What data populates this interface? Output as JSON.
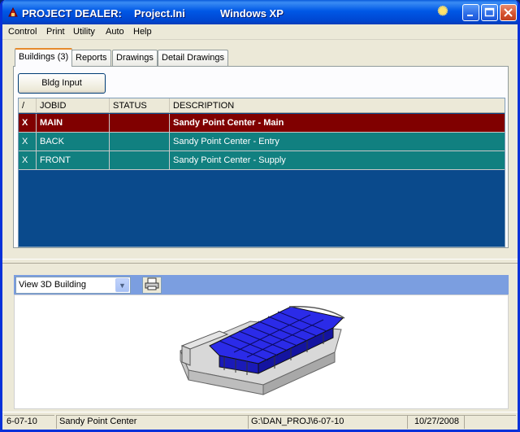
{
  "window": {
    "app_name": "PROJECT DEALER:",
    "project_file": "Project.Ini",
    "os_label": "Windows XP"
  },
  "menu": {
    "items": [
      {
        "label": "Control"
      },
      {
        "label": "Print"
      },
      {
        "label": "Utility"
      },
      {
        "label": "Auto"
      },
      {
        "label": "Help"
      }
    ]
  },
  "tabs": [
    {
      "label": "Buildings (3)",
      "active": true
    },
    {
      "label": "Reports",
      "active": false
    },
    {
      "label": "Drawings",
      "active": false
    },
    {
      "label": "Detail Drawings",
      "active": false
    }
  ],
  "buildings_panel": {
    "bldg_input_label": "Bldg Input",
    "columns": [
      {
        "label": "/"
      },
      {
        "label": "JOBID"
      },
      {
        "label": "STATUS"
      },
      {
        "label": "DESCRIPTION"
      }
    ],
    "rows": [
      {
        "mark": "X",
        "jobid": "MAIN",
        "status": "",
        "description": "Sandy Point Center - Main"
      },
      {
        "mark": "X",
        "jobid": "BACK",
        "status": "",
        "description": "Sandy Point Center - Entry"
      },
      {
        "mark": "X",
        "jobid": "FRONT",
        "status": "",
        "description": "Sandy Point Center - Supply"
      }
    ]
  },
  "viewer": {
    "selected_view": "View 3D Building",
    "print_icon": "printer-icon"
  },
  "status_bar": {
    "job_number": "6-07-10",
    "project_name": "Sandy Point Center",
    "path": "G:\\DAN_PROJ\\6-07-10",
    "date": "10/27/2008"
  },
  "colors": {
    "title_blue": "#0054e3",
    "selected_row": "#800000",
    "row_teal": "#118080",
    "grid_background": "#0a4a8c",
    "roof_blue": "#2a2ae6"
  }
}
